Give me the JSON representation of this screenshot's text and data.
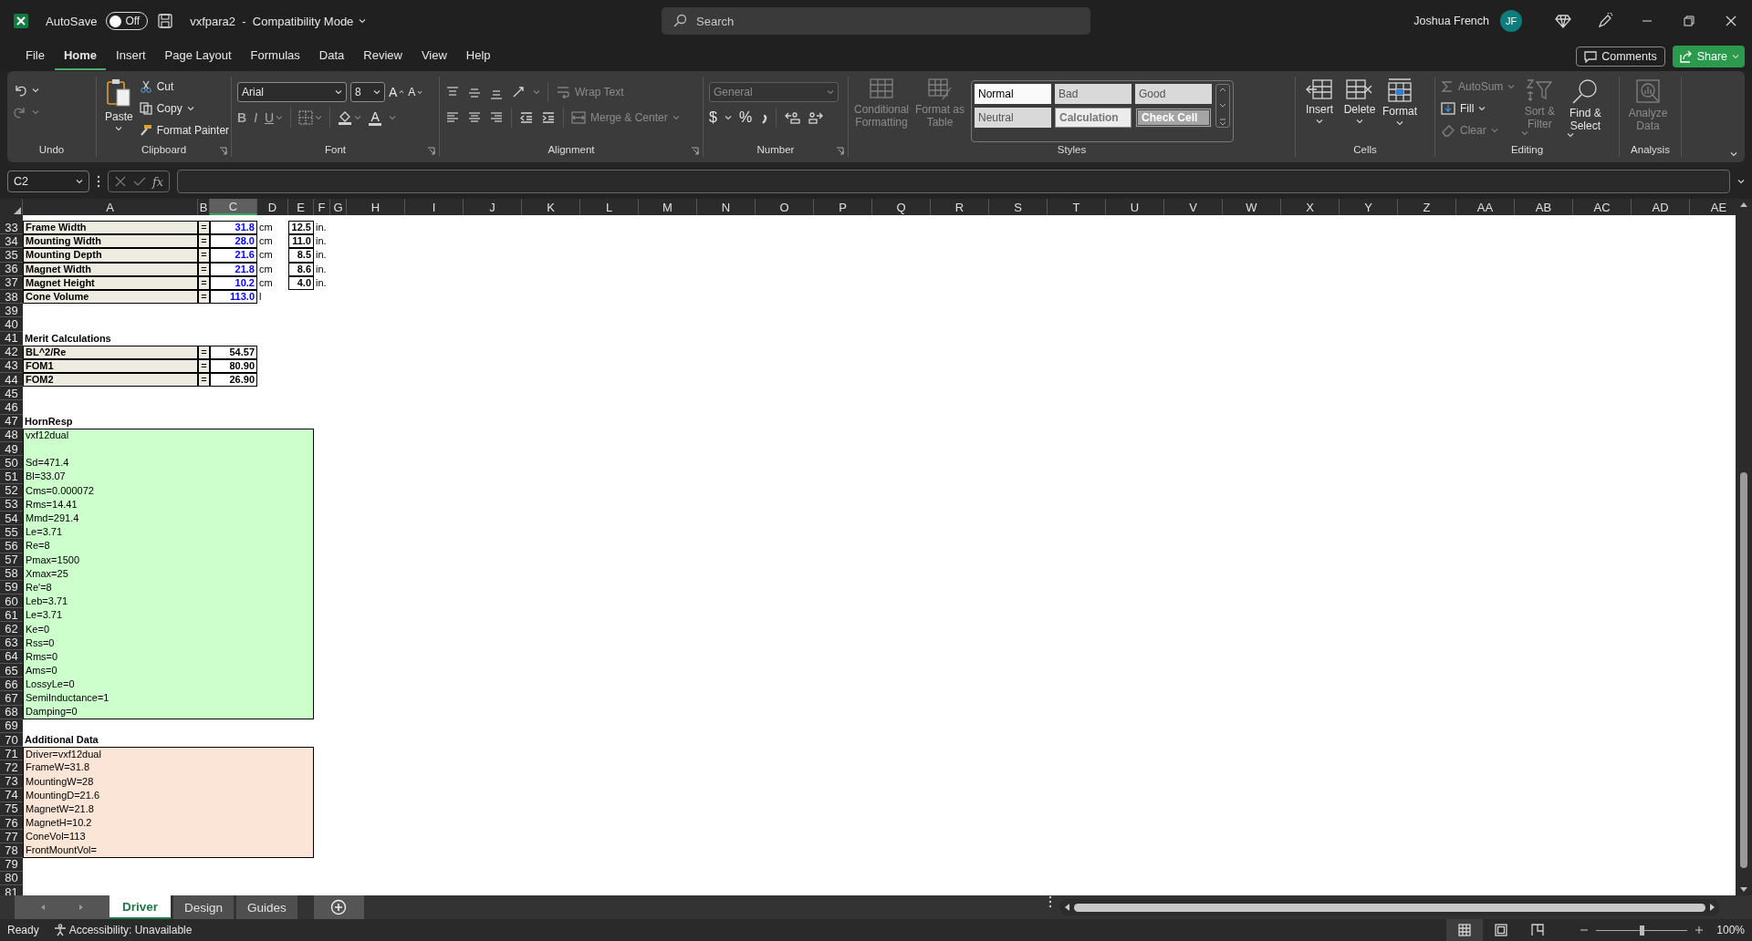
{
  "title_bar": {
    "autosave": {
      "label": "AutoSave",
      "on": false,
      "state_text": "Off"
    },
    "document_title": "vxfpara2  -  Compatibility Mode",
    "search": {
      "placeholder": "Search"
    },
    "user_name": "Joshua French",
    "avatar_initials": "JF"
  },
  "menu_tabs": [
    {
      "label": "File",
      "selected": false
    },
    {
      "label": "Home",
      "selected": true
    },
    {
      "label": "Insert",
      "selected": false
    },
    {
      "label": "Page Layout",
      "selected": false
    },
    {
      "label": "Formulas",
      "selected": false
    },
    {
      "label": "Data",
      "selected": false
    },
    {
      "label": "Review",
      "selected": false
    },
    {
      "label": "View",
      "selected": false
    },
    {
      "label": "Help",
      "selected": false
    }
  ],
  "comments_button": "Comments",
  "share_button": "Share",
  "ribbon": {
    "undo": {
      "label": "Undo"
    },
    "clipboard": {
      "label": "Clipboard",
      "paste": "Paste",
      "cut": "Cut",
      "copy": "Copy",
      "format_painter": "Format Painter"
    },
    "font": {
      "label": "Font",
      "font_name": "Arial",
      "font_size": "8",
      "grow": "A",
      "shrink": "A",
      "bold": "B",
      "italic": "I",
      "underline": "U",
      "font_color": "A"
    },
    "alignment": {
      "label": "Alignment",
      "wrap_text": {
        "label": "Wrap Text",
        "disabled": true
      },
      "merge_center": {
        "label": "Merge & Center",
        "disabled": true
      }
    },
    "number": {
      "label": "Number",
      "format": {
        "value": "General",
        "disabled": true
      },
      "currency": "$",
      "percent": "%"
    },
    "styles": {
      "label": "Styles",
      "commands": [
        {
          "label": "Conditional Formatting",
          "kind": "conditional",
          "disabled": true
        },
        {
          "label": "Format as Table",
          "kind": "table",
          "disabled": true
        }
      ],
      "gallery": [
        {
          "label": "Normal",
          "kind": "normal"
        },
        {
          "label": "Bad",
          "kind": "bad"
        },
        {
          "label": "Good",
          "kind": "good"
        },
        {
          "label": "Neutral",
          "kind": "neutral"
        },
        {
          "label": "Calculation",
          "kind": "calculation"
        },
        {
          "label": "Check Cell",
          "kind": "check"
        }
      ]
    },
    "cells": {
      "label": "Cells",
      "buttons": [
        {
          "label": "Insert",
          "kind": "insert"
        },
        {
          "label": "Delete",
          "kind": "delete"
        },
        {
          "label": "Format",
          "kind": "format"
        }
      ]
    },
    "editing": {
      "label": "Editing",
      "small": [
        {
          "label": "AutoSum",
          "kind": "sum",
          "disabled": true
        },
        {
          "label": "Fill",
          "kind": "fill",
          "disabled": false
        },
        {
          "label": "Clear",
          "kind": "clear",
          "disabled": true
        }
      ],
      "large": [
        {
          "label": "Sort & Filter",
          "kind": "sort",
          "disabled": true
        },
        {
          "label": "Find & Select",
          "kind": "find",
          "disabled": false
        }
      ]
    },
    "analysis": {
      "label": "Analysis",
      "analyze_data": {
        "label": "Analyze Data",
        "disabled": true
      }
    }
  },
  "formula_bar": {
    "name_box": "C2",
    "function_label": "fx"
  },
  "sheet": {
    "columns": [
      {
        "label": "A",
        "selected": false
      },
      {
        "label": "B",
        "selected": false
      },
      {
        "label": "C",
        "selected": true
      },
      {
        "label": "D",
        "selected": false
      },
      {
        "label": "E",
        "selected": false
      },
      {
        "label": "F",
        "selected": false
      },
      {
        "label": "G",
        "selected": false
      },
      {
        "label": "H",
        "selected": false
      },
      {
        "label": "I",
        "selected": false
      },
      {
        "label": "J",
        "selected": false
      },
      {
        "label": "K",
        "selected": false
      },
      {
        "label": "L",
        "selected": false
      },
      {
        "label": "M",
        "selected": false
      },
      {
        "label": "N",
        "selected": false
      },
      {
        "label": "O",
        "selected": false
      },
      {
        "label": "P",
        "selected": false
      },
      {
        "label": "Q",
        "selected": false
      },
      {
        "label": "R",
        "selected": false
      },
      {
        "label": "S",
        "selected": false
      },
      {
        "label": "T",
        "selected": false
      },
      {
        "label": "U",
        "selected": false
      },
      {
        "label": "V",
        "selected": false
      },
      {
        "label": "W",
        "selected": false
      },
      {
        "label": "X",
        "selected": false
      },
      {
        "label": "Y",
        "selected": false
      },
      {
        "label": "Z",
        "selected": false
      },
      {
        "label": "AA",
        "selected": false
      },
      {
        "label": "AB",
        "selected": false
      },
      {
        "label": "AC",
        "selected": false
      },
      {
        "label": "AD",
        "selected": false
      },
      {
        "label": "AE",
        "selected": false
      }
    ],
    "rows": [
      {
        "number": "33",
        "kind": "measure",
        "label": "Frame Width",
        "sign": "=",
        "value": "31.8",
        "input": true,
        "unit": "cm",
        "inches": "12.5",
        "inch_unit": "in."
      },
      {
        "number": "34",
        "kind": "measure",
        "label": "Mounting Width",
        "sign": "=",
        "value": "28.0",
        "input": true,
        "unit": "cm",
        "inches": "11.0",
        "inch_unit": "in."
      },
      {
        "number": "35",
        "kind": "measure",
        "label": "Mounting Depth",
        "sign": "=",
        "value": "21.6",
        "input": true,
        "unit": "cm",
        "inches": "8.5",
        "inch_unit": "in."
      },
      {
        "number": "36",
        "kind": "measure",
        "label": "Magnet Width",
        "sign": "=",
        "value": "21.8",
        "input": true,
        "unit": "cm",
        "inches": "8.6",
        "inch_unit": "in."
      },
      {
        "number": "37",
        "kind": "measure",
        "label": "Magnet Height",
        "sign": "=",
        "value": "10.2",
        "input": true,
        "unit": "cm",
        "inches": "4.0",
        "inch_unit": "in."
      },
      {
        "number": "38",
        "kind": "measure",
        "label": "Cone Volume",
        "sign": "=",
        "value": "113.0",
        "input": true,
        "unit": "l"
      },
      {
        "number": "39",
        "kind": "blank"
      },
      {
        "number": "40",
        "kind": "blank"
      },
      {
        "number": "41",
        "kind": "heading",
        "text": "Merit Calculations"
      },
      {
        "number": "42",
        "kind": "measure",
        "label": "BL^2/Re",
        "sign": "=",
        "value": "54.57",
        "input": false
      },
      {
        "number": "43",
        "kind": "measure",
        "label": "FOM1",
        "sign": "=",
        "value": "80.90",
        "input": false
      },
      {
        "number": "44",
        "kind": "measure",
        "label": "FOM2",
        "sign": "=",
        "value": "26.90",
        "input": false
      },
      {
        "number": "45",
        "kind": "blank"
      },
      {
        "number": "46",
        "kind": "blank"
      },
      {
        "number": "47",
        "kind": "heading",
        "text": "HornResp"
      },
      {
        "number": "48",
        "kind": "note",
        "color": "#ccffcc",
        "text": "vxf12dual"
      },
      {
        "number": "49",
        "kind": "note",
        "color": "#ccffcc"
      },
      {
        "number": "50",
        "kind": "note",
        "color": "#ccffcc",
        "text": "Sd=471.4"
      },
      {
        "number": "51",
        "kind": "note",
        "color": "#ccffcc",
        "text": "Bl=33.07"
      },
      {
        "number": "52",
        "kind": "note",
        "color": "#ccffcc",
        "text": "Cms=0.000072"
      },
      {
        "number": "53",
        "kind": "note",
        "color": "#ccffcc",
        "text": "Rms=14.41"
      },
      {
        "number": "54",
        "kind": "note",
        "color": "#ccffcc",
        "text": "Mmd=291.4"
      },
      {
        "number": "55",
        "kind": "note",
        "color": "#ccffcc",
        "text": "Le=3.71"
      },
      {
        "number": "56",
        "kind": "note",
        "color": "#ccffcc",
        "text": "Re=8"
      },
      {
        "number": "57",
        "kind": "note",
        "color": "#ccffcc",
        "text": "Pmax=1500"
      },
      {
        "number": "58",
        "kind": "note",
        "color": "#ccffcc",
        "text": "Xmax=25"
      },
      {
        "number": "59",
        "kind": "note",
        "color": "#ccffcc",
        "text": "Re'=8"
      },
      {
        "number": "60",
        "kind": "note",
        "color": "#ccffcc",
        "text": "Leb=3.71"
      },
      {
        "number": "61",
        "kind": "note",
        "color": "#ccffcc",
        "text": "Le=3.71"
      },
      {
        "number": "62",
        "kind": "note",
        "color": "#ccffcc",
        "text": "Ke=0"
      },
      {
        "number": "63",
        "kind": "note",
        "color": "#ccffcc",
        "text": "Rss=0"
      },
      {
        "number": "64",
        "kind": "note",
        "color": "#ccffcc",
        "text": "Rms=0"
      },
      {
        "number": "65",
        "kind": "note",
        "color": "#ccffcc",
        "text": "Ams=0"
      },
      {
        "number": "66",
        "kind": "note",
        "color": "#ccffcc",
        "text": "LossyLe=0"
      },
      {
        "number": "67",
        "kind": "note",
        "color": "#ccffcc",
        "text": "SemiInductance=1"
      },
      {
        "number": "68",
        "kind": "note",
        "color": "#ccffcc",
        "text": "Damping=0"
      },
      {
        "number": "69",
        "kind": "blank"
      },
      {
        "number": "70",
        "kind": "heading",
        "text": "Additional Data"
      },
      {
        "number": "71",
        "kind": "note",
        "color": "#fbe5d6",
        "text": "Driver=vxf12dual"
      },
      {
        "number": "72",
        "kind": "note",
        "color": "#fbe5d6",
        "text": "FrameW=31.8"
      },
      {
        "number": "73",
        "kind": "note",
        "color": "#fbe5d6",
        "text": "MountingW=28"
      },
      {
        "number": "74",
        "kind": "note",
        "color": "#fbe5d6",
        "text": "MountingD=21.6"
      },
      {
        "number": "75",
        "kind": "note",
        "color": "#fbe5d6",
        "text": "MagnetW=21.8"
      },
      {
        "number": "76",
        "kind": "note",
        "color": "#fbe5d6",
        "text": "MagnetH=10.2"
      },
      {
        "number": "77",
        "kind": "note",
        "color": "#fbe5d6",
        "text": "ConeVol=113"
      },
      {
        "number": "78",
        "kind": "note",
        "color": "#fbe5d6",
        "text": "FrontMountVol="
      },
      {
        "number": "79",
        "kind": "blank"
      },
      {
        "number": "80",
        "kind": "blank"
      },
      {
        "number": "81",
        "kind": "blank"
      }
    ]
  },
  "sheet_tabs": [
    {
      "label": "Driver",
      "selected": true
    },
    {
      "label": "Design",
      "selected": false
    },
    {
      "label": "Guides",
      "selected": false
    }
  ],
  "status_bar": {
    "ready": "Ready",
    "accessibility": "Accessibility: Unavailable",
    "views": [
      {
        "kind": "normal",
        "selected": true
      },
      {
        "kind": "page-layout",
        "selected": false
      },
      {
        "kind": "page-break",
        "selected": false
      }
    ],
    "zoom": {
      "level": 0.5,
      "reading": "100%"
    }
  }
}
